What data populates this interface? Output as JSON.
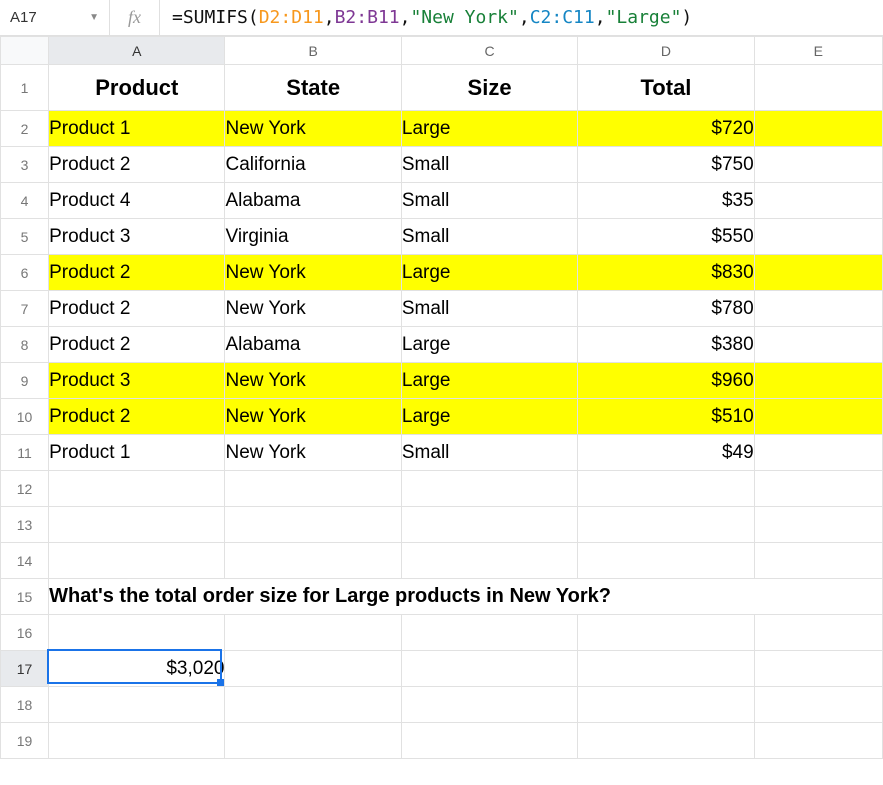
{
  "nameBox": "A17",
  "formula": {
    "prefix": "=",
    "fn": "SUMIFS",
    "open": "(",
    "arg1": "D2:D11",
    "c1": ",",
    "arg2": "B2:B11",
    "c2": ",",
    "arg3": "\"New York\"",
    "c3": ",",
    "arg4": "C2:C11",
    "c4": ",",
    "arg5": "\"Large\"",
    "close": ")"
  },
  "columns": [
    "A",
    "B",
    "C",
    "D",
    "E"
  ],
  "headerRow": {
    "product": "Product",
    "state": "State",
    "size": "Size",
    "total": "Total"
  },
  "rows": [
    {
      "n": 2,
      "product": "Product 1",
      "state": "New York",
      "size": "Large",
      "total": "$720",
      "hl": true
    },
    {
      "n": 3,
      "product": "Product 2",
      "state": "California",
      "size": "Small",
      "total": "$750",
      "hl": false
    },
    {
      "n": 4,
      "product": "Product 4",
      "state": "Alabama",
      "size": "Small",
      "total": "$35",
      "hl": false
    },
    {
      "n": 5,
      "product": "Product 3",
      "state": "Virginia",
      "size": "Small",
      "total": "$550",
      "hl": false
    },
    {
      "n": 6,
      "product": "Product 2",
      "state": "New York",
      "size": "Large",
      "total": "$830",
      "hl": true
    },
    {
      "n": 7,
      "product": "Product 2",
      "state": "New York",
      "size": "Small",
      "total": "$780",
      "hl": false
    },
    {
      "n": 8,
      "product": "Product 2",
      "state": "Alabama",
      "size": "Large",
      "total": "$380",
      "hl": false
    },
    {
      "n": 9,
      "product": "Product 3",
      "state": "New York",
      "size": "Large",
      "total": "$960",
      "hl": true
    },
    {
      "n": 10,
      "product": "Product 2",
      "state": "New York",
      "size": "Large",
      "total": "$510",
      "hl": true
    },
    {
      "n": 11,
      "product": "Product 1",
      "state": "New York",
      "size": "Small",
      "total": "$49",
      "hl": false
    }
  ],
  "question": "What's the total order size for Large products in New York?",
  "resultCell": {
    "row": 17,
    "value": "$3,020"
  },
  "emptyTrailingRows": [
    12,
    13,
    14,
    16,
    18,
    19
  ],
  "activeCell": {
    "col": "A",
    "row": 17
  }
}
